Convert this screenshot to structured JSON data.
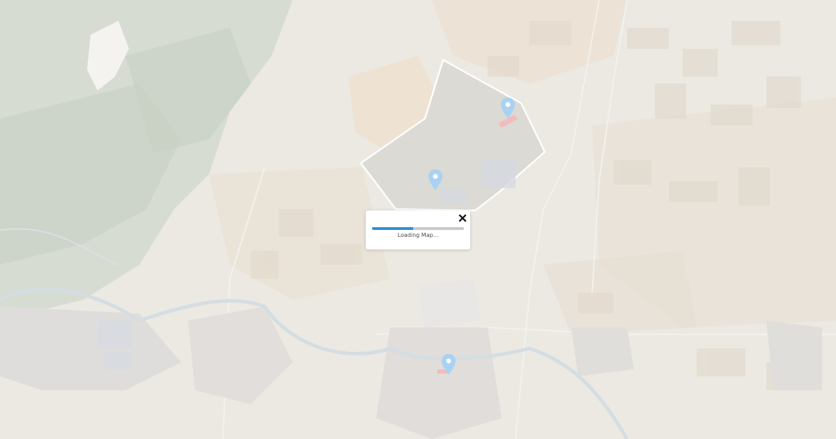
{
  "map": {
    "style": "satellite-washed",
    "colors": {
      "base": "#e9e6df",
      "vegetation": "#c9d1c6",
      "field_warm": "#e8d8c6",
      "town": "#d9d6d2",
      "river": "#cfd8dd",
      "boundary": "#ffffff",
      "pin": "#a9d2f2",
      "pin_marker_red": "#f2b3b3"
    },
    "markers": [
      {
        "name": "location-pin",
        "icon": "map-pin-icon"
      },
      {
        "name": "location-pin",
        "icon": "map-pin-icon"
      },
      {
        "name": "location-pin",
        "icon": "map-pin-icon"
      }
    ]
  },
  "loading_dialog": {
    "text": "Loading Map...",
    "progress": 0.45,
    "close_icon": "close-icon",
    "accent": "#2d8fd5"
  }
}
